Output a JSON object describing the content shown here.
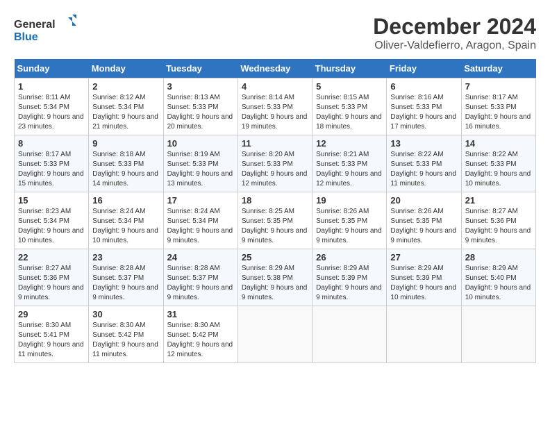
{
  "logo": {
    "text_general": "General",
    "text_blue": "Blue"
  },
  "header": {
    "title": "December 2024",
    "subtitle": "Oliver-Valdefierro, Aragon, Spain"
  },
  "weekdays": [
    "Sunday",
    "Monday",
    "Tuesday",
    "Wednesday",
    "Thursday",
    "Friday",
    "Saturday"
  ],
  "weeks": [
    [
      {
        "day": "1",
        "sunrise": "8:11 AM",
        "sunset": "5:34 PM",
        "daylight": "9 hours and 23 minutes."
      },
      {
        "day": "2",
        "sunrise": "8:12 AM",
        "sunset": "5:34 PM",
        "daylight": "9 hours and 21 minutes."
      },
      {
        "day": "3",
        "sunrise": "8:13 AM",
        "sunset": "5:33 PM",
        "daylight": "9 hours and 20 minutes."
      },
      {
        "day": "4",
        "sunrise": "8:14 AM",
        "sunset": "5:33 PM",
        "daylight": "9 hours and 19 minutes."
      },
      {
        "day": "5",
        "sunrise": "8:15 AM",
        "sunset": "5:33 PM",
        "daylight": "9 hours and 18 minutes."
      },
      {
        "day": "6",
        "sunrise": "8:16 AM",
        "sunset": "5:33 PM",
        "daylight": "9 hours and 17 minutes."
      },
      {
        "day": "7",
        "sunrise": "8:17 AM",
        "sunset": "5:33 PM",
        "daylight": "9 hours and 16 minutes."
      }
    ],
    [
      {
        "day": "8",
        "sunrise": "8:17 AM",
        "sunset": "5:33 PM",
        "daylight": "9 hours and 15 minutes."
      },
      {
        "day": "9",
        "sunrise": "8:18 AM",
        "sunset": "5:33 PM",
        "daylight": "9 hours and 14 minutes."
      },
      {
        "day": "10",
        "sunrise": "8:19 AM",
        "sunset": "5:33 PM",
        "daylight": "9 hours and 13 minutes."
      },
      {
        "day": "11",
        "sunrise": "8:20 AM",
        "sunset": "5:33 PM",
        "daylight": "9 hours and 12 minutes."
      },
      {
        "day": "12",
        "sunrise": "8:21 AM",
        "sunset": "5:33 PM",
        "daylight": "9 hours and 12 minutes."
      },
      {
        "day": "13",
        "sunrise": "8:22 AM",
        "sunset": "5:33 PM",
        "daylight": "9 hours and 11 minutes."
      },
      {
        "day": "14",
        "sunrise": "8:22 AM",
        "sunset": "5:33 PM",
        "daylight": "9 hours and 10 minutes."
      }
    ],
    [
      {
        "day": "15",
        "sunrise": "8:23 AM",
        "sunset": "5:34 PM",
        "daylight": "9 hours and 10 minutes."
      },
      {
        "day": "16",
        "sunrise": "8:24 AM",
        "sunset": "5:34 PM",
        "daylight": "9 hours and 10 minutes."
      },
      {
        "day": "17",
        "sunrise": "8:24 AM",
        "sunset": "5:34 PM",
        "daylight": "9 hours and 9 minutes."
      },
      {
        "day": "18",
        "sunrise": "8:25 AM",
        "sunset": "5:35 PM",
        "daylight": "9 hours and 9 minutes."
      },
      {
        "day": "19",
        "sunrise": "8:26 AM",
        "sunset": "5:35 PM",
        "daylight": "9 hours and 9 minutes."
      },
      {
        "day": "20",
        "sunrise": "8:26 AM",
        "sunset": "5:35 PM",
        "daylight": "9 hours and 9 minutes."
      },
      {
        "day": "21",
        "sunrise": "8:27 AM",
        "sunset": "5:36 PM",
        "daylight": "9 hours and 9 minutes."
      }
    ],
    [
      {
        "day": "22",
        "sunrise": "8:27 AM",
        "sunset": "5:36 PM",
        "daylight": "9 hours and 9 minutes."
      },
      {
        "day": "23",
        "sunrise": "8:28 AM",
        "sunset": "5:37 PM",
        "daylight": "9 hours and 9 minutes."
      },
      {
        "day": "24",
        "sunrise": "8:28 AM",
        "sunset": "5:37 PM",
        "daylight": "9 hours and 9 minutes."
      },
      {
        "day": "25",
        "sunrise": "8:29 AM",
        "sunset": "5:38 PM",
        "daylight": "9 hours and 9 minutes."
      },
      {
        "day": "26",
        "sunrise": "8:29 AM",
        "sunset": "5:39 PM",
        "daylight": "9 hours and 9 minutes."
      },
      {
        "day": "27",
        "sunrise": "8:29 AM",
        "sunset": "5:39 PM",
        "daylight": "9 hours and 10 minutes."
      },
      {
        "day": "28",
        "sunrise": "8:29 AM",
        "sunset": "5:40 PM",
        "daylight": "9 hours and 10 minutes."
      }
    ],
    [
      {
        "day": "29",
        "sunrise": "8:30 AM",
        "sunset": "5:41 PM",
        "daylight": "9 hours and 11 minutes."
      },
      {
        "day": "30",
        "sunrise": "8:30 AM",
        "sunset": "5:42 PM",
        "daylight": "9 hours and 11 minutes."
      },
      {
        "day": "31",
        "sunrise": "8:30 AM",
        "sunset": "5:42 PM",
        "daylight": "9 hours and 12 minutes."
      },
      null,
      null,
      null,
      null
    ]
  ],
  "labels": {
    "sunrise": "Sunrise:",
    "sunset": "Sunset:",
    "daylight": "Daylight:"
  }
}
